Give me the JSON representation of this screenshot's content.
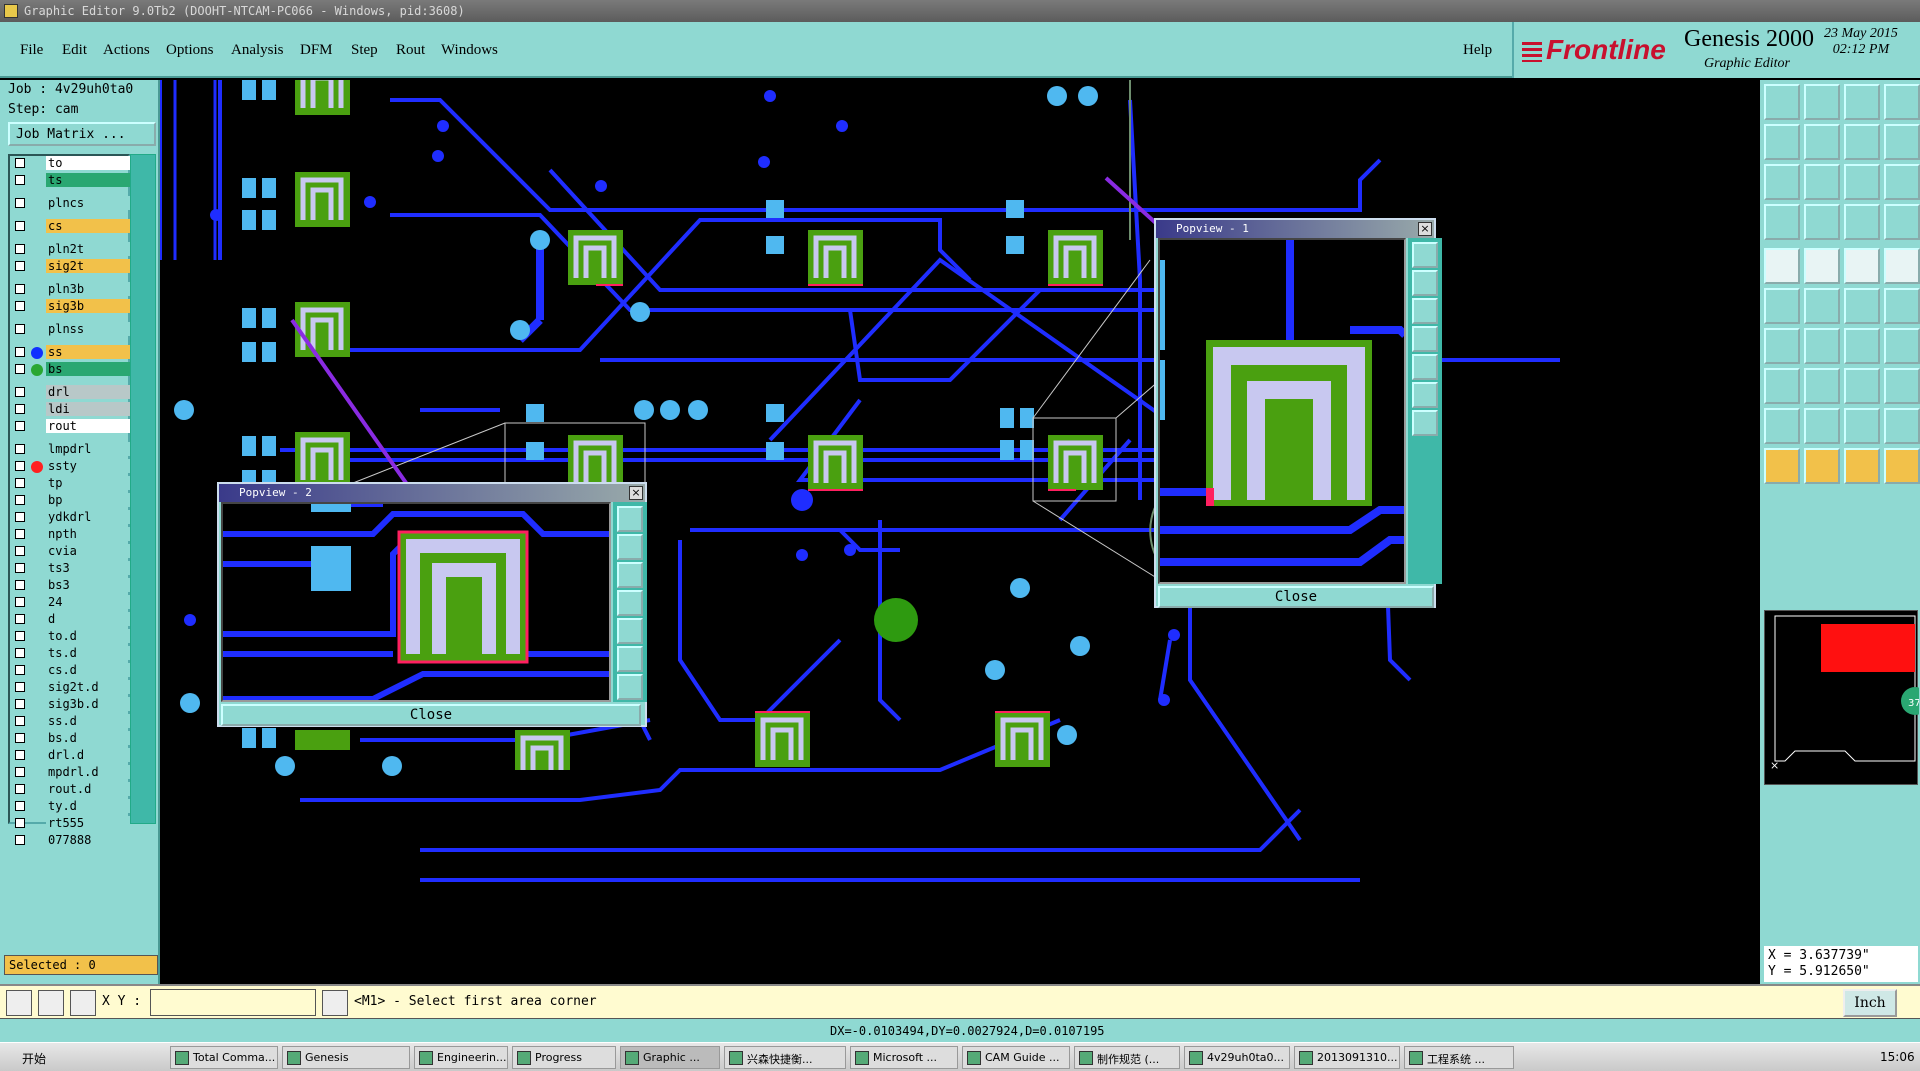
{
  "window": {
    "title": "Graphic Editor 9.0Tb2 (DOOHT-NTCAM-PC066 - Windows, pid:3608)"
  },
  "menu": {
    "items": [
      "File",
      "Edit",
      "Actions",
      "Options",
      "Analysis",
      "DFM",
      "Step",
      "Rout",
      "Windows"
    ],
    "help": "Help"
  },
  "brand": {
    "logo": "Frontline",
    "product": "Genesis 2000",
    "subtitle": "Graphic Editor",
    "date": "23 May 2015",
    "time": "02:12 PM"
  },
  "job": {
    "job_label": "Job : 4v29uh0ta0",
    "step_label": "Step: cam",
    "matrix_button": "Job Matrix ..."
  },
  "layers": [
    {
      "name": "to",
      "color": "#ffffff",
      "dot": ""
    },
    {
      "name": "ts",
      "color": "#2aa772",
      "dot": ""
    },
    {
      "sep": true
    },
    {
      "name": "plncs",
      "color": "#8fd9d2",
      "dot": ""
    },
    {
      "sep": true
    },
    {
      "name": "cs",
      "color": "#f2c14a",
      "dot": ""
    },
    {
      "sep": true
    },
    {
      "name": "pln2t",
      "color": "#8fd9d2",
      "dot": ""
    },
    {
      "name": "sig2t",
      "color": "#f2c14a",
      "dot": ""
    },
    {
      "sep": true
    },
    {
      "name": "pln3b",
      "color": "#8fd9d2",
      "dot": ""
    },
    {
      "name": "sig3b",
      "color": "#f2c14a",
      "dot": ""
    },
    {
      "sep": true
    },
    {
      "name": "plnss",
      "color": "#8fd9d2",
      "dot": ""
    },
    {
      "sep": true
    },
    {
      "name": "ss",
      "color": "#f2c14a",
      "dot": "#1030ff"
    },
    {
      "name": "bs",
      "color": "#2aa772",
      "dot": "#2aa732"
    },
    {
      "sep": true
    },
    {
      "name": "drl",
      "color": "#b8c8c8",
      "dot": ""
    },
    {
      "name": "ldi",
      "color": "#b8c8c8",
      "dot": ""
    },
    {
      "name": "rout",
      "color": "#ffffff",
      "dot": ""
    },
    {
      "sep": true
    },
    {
      "name": "lmpdrl",
      "color": "#8fd9d2",
      "dot": ""
    },
    {
      "name": "ssty",
      "color": "#8fd9d2",
      "dot": "#ff2020"
    },
    {
      "name": "tp",
      "color": "#8fd9d2",
      "dot": ""
    },
    {
      "name": "bp",
      "color": "#8fd9d2",
      "dot": ""
    },
    {
      "name": "ydkdrl",
      "color": "#8fd9d2",
      "dot": ""
    },
    {
      "name": "npth",
      "color": "#8fd9d2",
      "dot": ""
    },
    {
      "name": "cvia",
      "color": "#8fd9d2",
      "dot": ""
    },
    {
      "name": "ts3",
      "color": "#8fd9d2",
      "dot": ""
    },
    {
      "name": "bs3",
      "color": "#8fd9d2",
      "dot": ""
    },
    {
      "name": "24",
      "color": "#8fd9d2",
      "dot": ""
    },
    {
      "name": "d",
      "color": "#8fd9d2",
      "dot": ""
    },
    {
      "name": "to.d",
      "color": "#8fd9d2",
      "dot": ""
    },
    {
      "name": "ts.d",
      "color": "#8fd9d2",
      "dot": ""
    },
    {
      "name": "cs.d",
      "color": "#8fd9d2",
      "dot": ""
    },
    {
      "name": "sig2t.d",
      "color": "#8fd9d2",
      "dot": ""
    },
    {
      "name": "sig3b.d",
      "color": "#8fd9d2",
      "dot": ""
    },
    {
      "name": "ss.d",
      "color": "#8fd9d2",
      "dot": ""
    },
    {
      "name": "bs.d",
      "color": "#8fd9d2",
      "dot": ""
    },
    {
      "name": "drl.d",
      "color": "#8fd9d2",
      "dot": ""
    },
    {
      "name": "mpdrl.d",
      "color": "#8fd9d2",
      "dot": ""
    },
    {
      "name": "rout.d",
      "color": "#8fd9d2",
      "dot": ""
    },
    {
      "name": "ty.d",
      "color": "#8fd9d2",
      "dot": ""
    },
    {
      "name": "rt555",
      "color": "#8fd9d2",
      "dot": ""
    },
    {
      "name": "077888",
      "color": "#8fd9d2",
      "dot": ""
    }
  ],
  "selected": "Selected : 0",
  "popview1": {
    "title": "Popview - 1",
    "close": "Close"
  },
  "popview2": {
    "title": "Popview - 2",
    "close": "Close"
  },
  "coords": {
    "x": "X = 3.637739\"",
    "y": "Y = 5.912650\""
  },
  "minimap": {
    "badge": "37"
  },
  "cmd": {
    "xy_label": "X Y :",
    "xy_value": "",
    "prompt": "<M1> - Select first area corner",
    "units": "Inch"
  },
  "status": {
    "delta": "DX=-0.0103494,DY=0.0027924,D=0.0107195"
  },
  "taskbar": {
    "start": "开始",
    "tasks": [
      "Total Comma...",
      "Genesis",
      "Engineerin...",
      "Progress",
      "Graphic ...",
      "兴森快捷衡...",
      "Microsoft ...",
      "CAM Guide ...",
      "制作规范 (...",
      "4v29uh0ta0...",
      "2013091310...",
      "工程系统 ..."
    ],
    "clock": "15:06"
  },
  "colors": {
    "panel": "#8fd9d2",
    "trace": "#1f2dff",
    "pad": "#4fb8f0",
    "copper": "#4aa010",
    "outline": "#c8c8f0",
    "mask": "#ff2060"
  }
}
